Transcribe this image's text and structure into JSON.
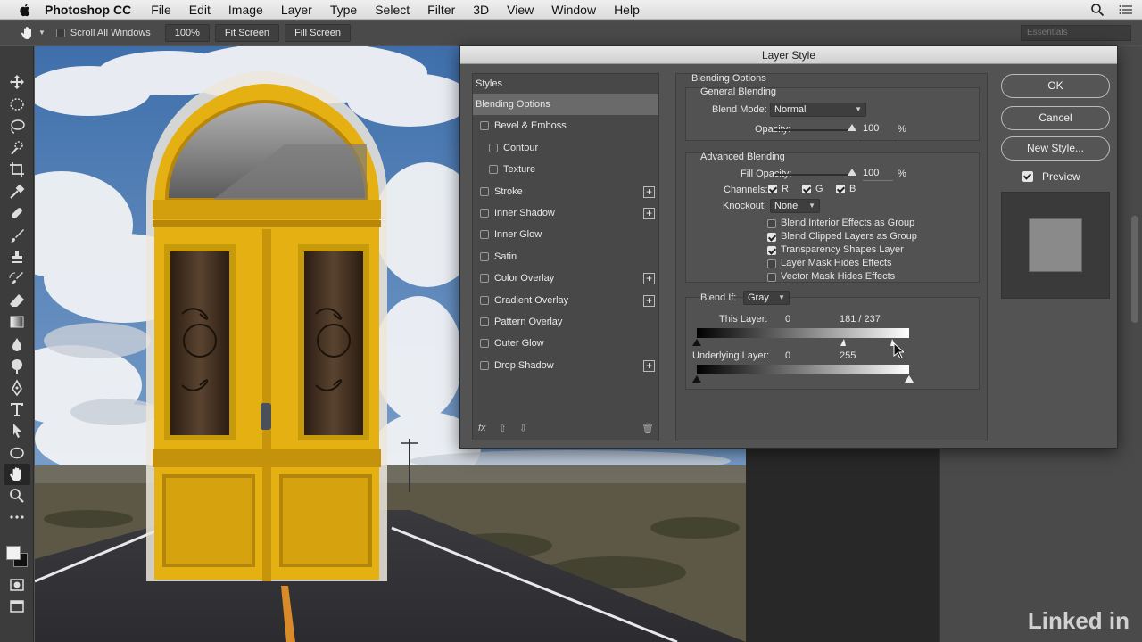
{
  "menubar": {
    "app_name": "Photoshop CC",
    "menus": [
      "File",
      "Edit",
      "Image",
      "Layer",
      "Type",
      "Select",
      "Filter",
      "3D",
      "View",
      "Window",
      "Help"
    ]
  },
  "options_bar": {
    "scroll_all_windows": "Scroll All Windows",
    "zoom": "100%",
    "fit_screen": "Fit Screen",
    "fill_screen": "Fill Screen",
    "workspace": "Essentials"
  },
  "dialog": {
    "title": "Layer Style",
    "styles_header": "Styles",
    "style_items": [
      {
        "label": "Blending Options",
        "checkbox": false,
        "plus": false,
        "selected": true,
        "indent": 0
      },
      {
        "label": "Bevel & Emboss",
        "checkbox": true,
        "plus": false,
        "selected": false,
        "indent": 0
      },
      {
        "label": "Contour",
        "checkbox": true,
        "plus": false,
        "selected": false,
        "indent": 1
      },
      {
        "label": "Texture",
        "checkbox": true,
        "plus": false,
        "selected": false,
        "indent": 1
      },
      {
        "label": "Stroke",
        "checkbox": true,
        "plus": true,
        "selected": false,
        "indent": 0
      },
      {
        "label": "Inner Shadow",
        "checkbox": true,
        "plus": true,
        "selected": false,
        "indent": 0
      },
      {
        "label": "Inner Glow",
        "checkbox": true,
        "plus": false,
        "selected": false,
        "indent": 0
      },
      {
        "label": "Satin",
        "checkbox": true,
        "plus": false,
        "selected": false,
        "indent": 0
      },
      {
        "label": "Color Overlay",
        "checkbox": true,
        "plus": true,
        "selected": false,
        "indent": 0
      },
      {
        "label": "Gradient Overlay",
        "checkbox": true,
        "plus": true,
        "selected": false,
        "indent": 0
      },
      {
        "label": "Pattern Overlay",
        "checkbox": true,
        "plus": false,
        "selected": false,
        "indent": 0
      },
      {
        "label": "Outer Glow",
        "checkbox": true,
        "plus": false,
        "selected": false,
        "indent": 0
      },
      {
        "label": "Drop Shadow",
        "checkbox": true,
        "plus": true,
        "selected": false,
        "indent": 0
      }
    ],
    "fx_label": "fx",
    "blending": {
      "section_title": "Blending Options",
      "general_title": "General Blending",
      "blend_mode_label": "Blend Mode:",
      "blend_mode_value": "Normal",
      "opacity_label": "Opacity:",
      "opacity_value": "100",
      "percent": "%",
      "advanced_title": "Advanced Blending",
      "fill_opacity_label": "Fill Opacity:",
      "fill_opacity_value": "100",
      "channels_label": "Channels:",
      "channels": [
        {
          "label": "R",
          "checked": true
        },
        {
          "label": "G",
          "checked": true
        },
        {
          "label": "B",
          "checked": true
        }
      ],
      "knockout_label": "Knockout:",
      "knockout_value": "None",
      "options": [
        {
          "label": "Blend Interior Effects as Group",
          "checked": false
        },
        {
          "label": "Blend Clipped Layers as Group",
          "checked": true
        },
        {
          "label": "Transparency Shapes Layer",
          "checked": true
        },
        {
          "label": "Layer Mask Hides Effects",
          "checked": false
        },
        {
          "label": "Vector Mask Hides Effects",
          "checked": false
        }
      ],
      "blend_if_label": "Blend If:",
      "blend_if_value": "Gray",
      "this_layer_label": "This Layer:",
      "this_layer_low": "0",
      "this_layer_high": "181 / 237",
      "underlying_label": "Underlying Layer:",
      "underlying_low": "0",
      "underlying_high": "255"
    },
    "buttons": {
      "ok": "OK",
      "cancel": "Cancel",
      "new_style": "New Style...",
      "preview": "Preview"
    }
  },
  "watermark": "Linked in"
}
